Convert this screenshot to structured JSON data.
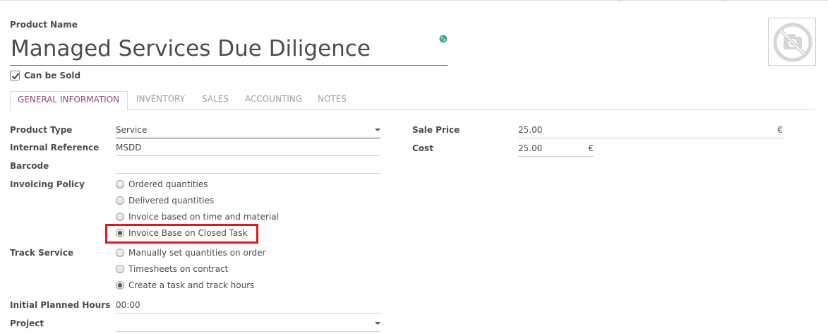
{
  "header": {
    "product_name_label": "Product Name",
    "product_name_value": "Managed Services Due Diligence",
    "can_be_sold_label": "Can be Sold",
    "can_be_sold_checked": true
  },
  "tabs": [
    {
      "label": "GENERAL INFORMATION",
      "active": true
    },
    {
      "label": "INVENTORY",
      "active": false
    },
    {
      "label": "SALES",
      "active": false
    },
    {
      "label": "ACCOUNTING",
      "active": false
    },
    {
      "label": "NOTES",
      "active": false
    }
  ],
  "left": {
    "product_type": {
      "label": "Product Type",
      "value": "Service"
    },
    "internal_reference": {
      "label": "Internal Reference",
      "value": "MSDD"
    },
    "barcode": {
      "label": "Barcode",
      "value": ""
    },
    "invoicing_policy": {
      "label": "Invoicing Policy",
      "options": [
        {
          "label": "Ordered quantities",
          "selected": false
        },
        {
          "label": "Delivered quantities",
          "selected": false
        },
        {
          "label": "Invoice based on time and material",
          "selected": false
        },
        {
          "label": "Invoice Base on Closed Task",
          "selected": true
        }
      ]
    },
    "track_service": {
      "label": "Track Service",
      "options": [
        {
          "label": "Manually set quantities on order",
          "selected": false
        },
        {
          "label": "Timesheets on contract",
          "selected": false
        },
        {
          "label": "Create a task and track hours",
          "selected": true
        }
      ]
    },
    "initial_planned_hours": {
      "label": "Initial Planned Hours",
      "value": "00:00"
    },
    "project": {
      "label": "Project",
      "value": ""
    }
  },
  "right": {
    "sale_price": {
      "label": "Sale Price",
      "value": "25.00",
      "currency": "€"
    },
    "cost": {
      "label": "Cost",
      "value": "25.00",
      "currency": "€"
    }
  },
  "colors": {
    "accent": "#8b4c7e",
    "highlight": "#e3161d",
    "globe": "#3fae8c"
  },
  "icons": {
    "photo_placeholder": "no-camera-icon",
    "translate": "globe-icon",
    "checkbox": "checkmark-icon"
  }
}
